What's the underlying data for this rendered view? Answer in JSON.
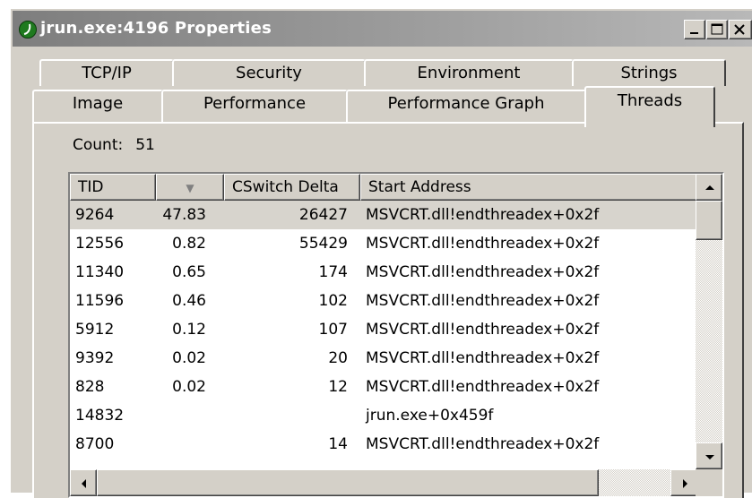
{
  "window": {
    "title": "jrun.exe:4196 Properties"
  },
  "tabs": {
    "row1": [
      {
        "label": "TCP/IP"
      },
      {
        "label": "Security"
      },
      {
        "label": "Environment"
      },
      {
        "label": "Strings"
      }
    ],
    "row2": [
      {
        "label": "Image"
      },
      {
        "label": "Performance"
      },
      {
        "label": "Performance Graph"
      },
      {
        "label": "Threads"
      }
    ],
    "selected": "Threads"
  },
  "count": {
    "label": "Count:",
    "value": "51"
  },
  "table": {
    "columns": [
      "TID",
      "",
      "CSwitch Delta",
      "Start Address"
    ],
    "sorted_column_indicator": "▼",
    "selected_row_index": 0,
    "rows": [
      {
        "tid": "9264",
        "cpu": "47.83",
        "cswitch": "26427",
        "start": "MSVCRT.dll!endthreadex+0x2f"
      },
      {
        "tid": "12556",
        "cpu": "0.82",
        "cswitch": "55429",
        "start": "MSVCRT.dll!endthreadex+0x2f"
      },
      {
        "tid": "11340",
        "cpu": "0.65",
        "cswitch": "174",
        "start": "MSVCRT.dll!endthreadex+0x2f"
      },
      {
        "tid": "11596",
        "cpu": "0.46",
        "cswitch": "102",
        "start": "MSVCRT.dll!endthreadex+0x2f"
      },
      {
        "tid": "5912",
        "cpu": "0.12",
        "cswitch": "107",
        "start": "MSVCRT.dll!endthreadex+0x2f"
      },
      {
        "tid": "9392",
        "cpu": "0.02",
        "cswitch": "20",
        "start": "MSVCRT.dll!endthreadex+0x2f"
      },
      {
        "tid": "828",
        "cpu": "0.02",
        "cswitch": "12",
        "start": "MSVCRT.dll!endthreadex+0x2f"
      },
      {
        "tid": "14832",
        "cpu": "",
        "cswitch": "",
        "start": "jrun.exe+0x459f"
      },
      {
        "tid": "8700",
        "cpu": "",
        "cswitch": "14",
        "start": "MSVCRT.dll!endthreadex+0x2f"
      }
    ]
  },
  "icons": {
    "app": "jrun-app-icon",
    "minimize": "minimize-icon",
    "maximize": "maximize-icon",
    "close": "close-icon",
    "scroll_up": "scroll-up-arrow-icon",
    "scroll_down": "scroll-down-arrow-icon",
    "scroll_left": "scroll-left-arrow-icon",
    "scroll_right": "scroll-right-arrow-icon"
  },
  "colors": {
    "titlebar_inactive": "#9a9a9a",
    "face": "#d4d0c8",
    "selected_row": "#d7d4cd"
  }
}
